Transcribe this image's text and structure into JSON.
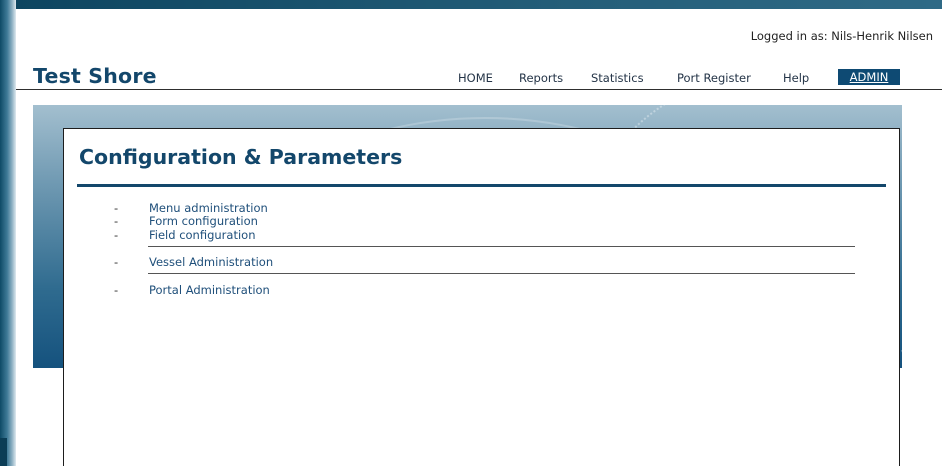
{
  "header": {
    "login_info": "Logged in as: Nils-Henrik Nilsen",
    "site_title": "Test Shore"
  },
  "nav": {
    "items": [
      "HOME",
      "Reports",
      "Statistics",
      "Port Register",
      "Help"
    ],
    "admin": "ADMIN"
  },
  "main": {
    "title": "Configuration & Parameters",
    "groups": [
      {
        "items": [
          "Menu administration",
          "Form configuration",
          "Field configuration"
        ]
      },
      {
        "items": [
          "Vessel Administration"
        ]
      },
      {
        "items": [
          "Portal Administration"
        ]
      }
    ],
    "dash": "-"
  },
  "colors": {
    "brand": "#13476b",
    "nav_active_bg": "#0e4a73",
    "link": "#1f4f7a"
  }
}
